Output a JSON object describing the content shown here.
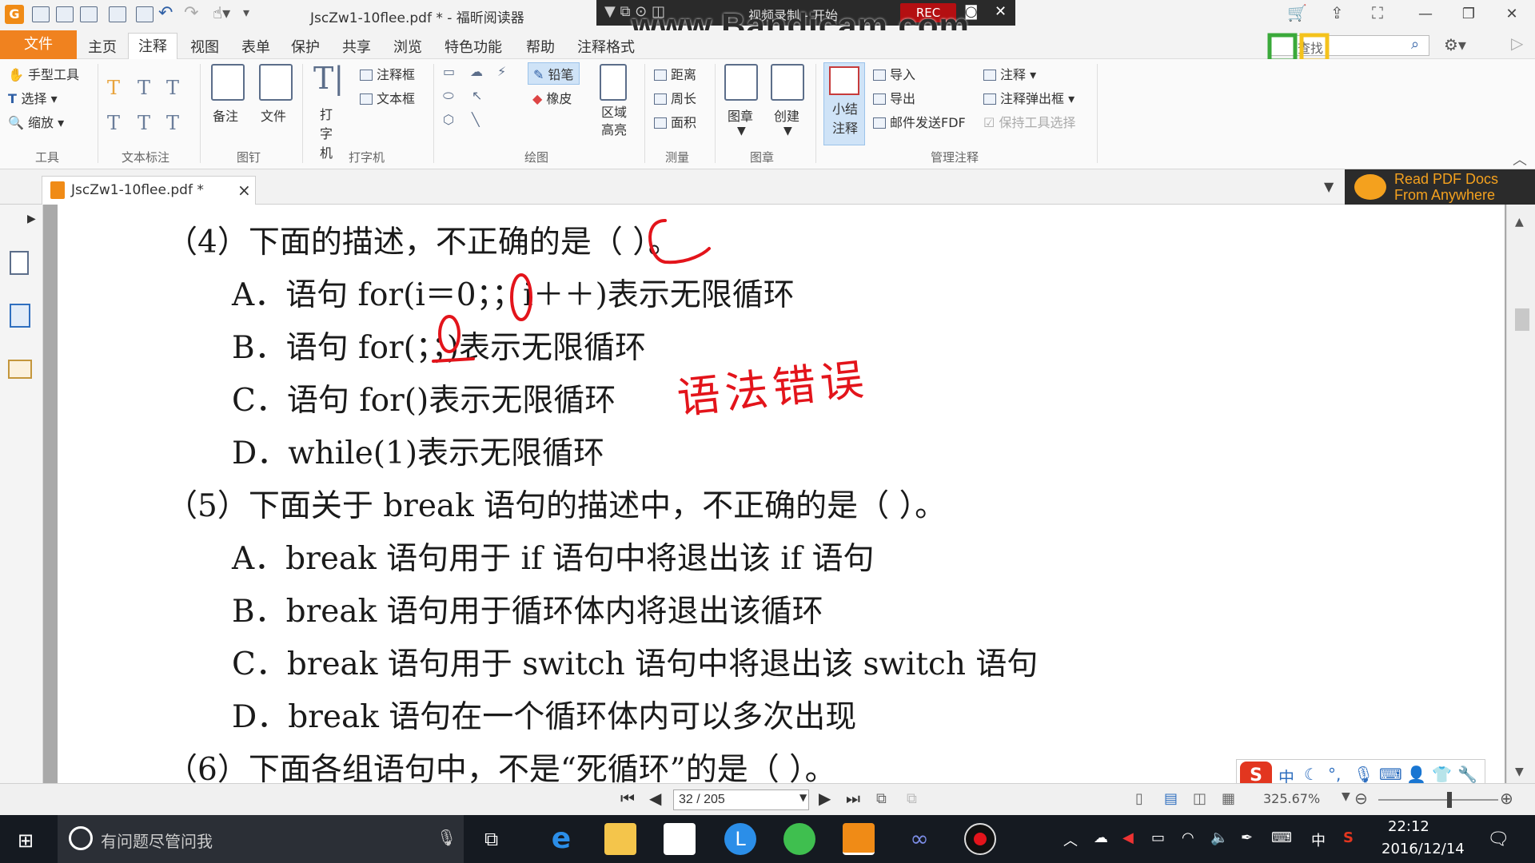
{
  "titlebar": {
    "title": "JscZw1-10flee.pdf * - 福昕阅读器",
    "recorder_label": "视频录制 - 开始",
    "rec_button": "REC",
    "watermark": "www.Bandicam.com"
  },
  "menu": {
    "file": "文件",
    "items": [
      "主页",
      "注释",
      "视图",
      "表单",
      "保护",
      "共享",
      "浏览",
      "特色功能",
      "帮助",
      "注释格式"
    ],
    "active": "注释",
    "search_placeholder": "查找"
  },
  "ribbon": {
    "tools": {
      "hand": "手型工具",
      "select": "选择",
      "zoom": "缩放",
      "group": "工具"
    },
    "text_markup": {
      "group": "文本标注"
    },
    "pin": {
      "note": "备注",
      "file": "文件",
      "group": "图钉"
    },
    "typewriter": {
      "typewriter": "打字机",
      "callout": "注释框",
      "textbox": "文本框",
      "group": "打字机"
    },
    "drawing": {
      "pencil": "铅笔",
      "eraser": "橡皮",
      "area_highlight": "区域高亮",
      "group": "绘图"
    },
    "measure": {
      "distance": "距离",
      "perimeter": "周长",
      "area": "面积",
      "group": "测量"
    },
    "stamp": {
      "stamp": "图章",
      "create": "创建",
      "group": "图章"
    },
    "manage": {
      "summary": "小结注释",
      "import": "导入",
      "export": "导出",
      "email": "邮件发送FDF",
      "annotation": "注释",
      "popup": "注释弹出框",
      "keep_tool": "保持工具选择",
      "group": "管理注释"
    }
  },
  "tab": {
    "label": "JscZw1-10flee.pdf *",
    "close": "×"
  },
  "ad": {
    "line1": "Read PDF Docs",
    "line2": "From Anywhere"
  },
  "document": {
    "q4": "（4）下面的描述，不正确的是（      ）。",
    "q4a": "A．语句 for(i＝0；；i＋＋)表示无限循环",
    "q4b": "B．语句 for(；；)表示无限循环",
    "q4c": "C．语句 for()表示无限循环",
    "q4d": "D．while(1)表示无限循环",
    "q5": "（5）下面关于 break 语句的描述中，不正确的是（        ）。",
    "q5a": "A．break 语句用于 if 语句中将退出该 if 语句",
    "q5b": "B．break 语句用于循环体内将退出该循环",
    "q5c": "C．break 语句用于 switch 语句中将退出该 switch 语句",
    "q5d": "D．break 语句在一个循环体内可以多次出现",
    "q6": "（6）下面各组语句中，不是“死循环”的是（        ）。",
    "handwriting": "语法错误"
  },
  "status": {
    "page": "32 / 205",
    "zoom": "325.67%"
  },
  "taskbar": {
    "search": "有问题尽管问我",
    "time": "22:12",
    "date": "2016/12/14",
    "ime_lang": "中"
  },
  "ime": {
    "lang": "中"
  },
  "colors": {
    "accent": "#f0821f",
    "annotation_red": "#e3141b",
    "taskbar": "#151a21"
  }
}
